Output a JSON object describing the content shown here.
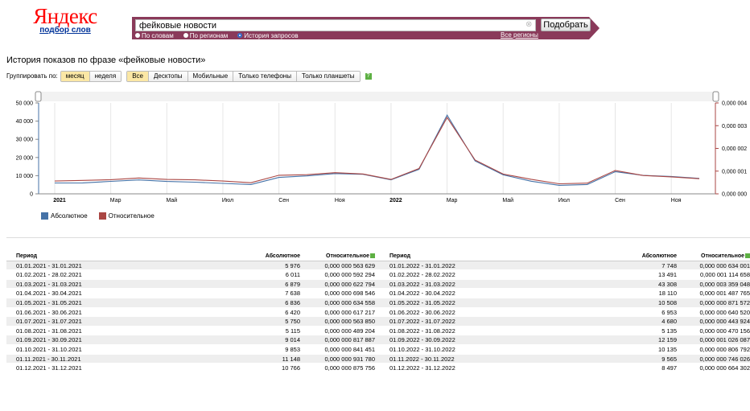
{
  "header": {
    "logo_text": "Яндекс",
    "logo_sub": "подбор слов",
    "search_value": "фейковые новости",
    "search_button": "Подобрать",
    "radios": [
      {
        "label": "По словам",
        "selected": false
      },
      {
        "label": "По регионам",
        "selected": false
      },
      {
        "label": "История запросов",
        "selected": true
      }
    ],
    "all_regions": "Все регионы",
    "panel_color": "#8a3a5a"
  },
  "page_title": "История показов по фразе «фейковые новости»",
  "group": {
    "label": "Группировать по:",
    "period_options": [
      {
        "label": "месяц",
        "active": true
      },
      {
        "label": "неделя",
        "active": false
      }
    ],
    "device_options": [
      {
        "label": "Все",
        "active": true
      },
      {
        "label": "Десктопы",
        "active": false
      },
      {
        "label": "Мобильные",
        "active": false
      },
      {
        "label": "Только телефоны",
        "active": false
      },
      {
        "label": "Только планшеты",
        "active": false
      }
    ],
    "help": "?"
  },
  "chart_data": {
    "type": "line",
    "x_labels": [
      "2021",
      "Мар",
      "Май",
      "Июл",
      "Сен",
      "Ноя",
      "2022",
      "Мар",
      "Май",
      "Июл",
      "Сен",
      "Ноя"
    ],
    "x_labels_bold": [
      "2021",
      "2022"
    ],
    "left_ticks": [
      "50 000",
      "40 000",
      "30 000",
      "20 000",
      "10 000",
      "0"
    ],
    "right_ticks": [
      "0,000 004",
      "0,000 003",
      "0,000 002",
      "0,000 001",
      "0,000 000"
    ],
    "ylim_left": [
      0,
      50000
    ],
    "ylim_right": [
      0,
      4e-06
    ],
    "series": [
      {
        "name": "Абсолютное",
        "color": "#4572a7",
        "values": [
          5976,
          6011,
          6879,
          7638,
          6836,
          6420,
          5750,
          5115,
          9014,
          9853,
          11148,
          10766,
          7748,
          13491,
          43308,
          18110,
          10508,
          6953,
          4680,
          5135,
          12159,
          10135,
          9565,
          8497
        ]
      },
      {
        "name": "Относительное",
        "color": "#aa4643",
        "values": [
          5.63629e-07,
          5.92294e-07,
          6.22794e-07,
          6.98546e-07,
          6.34558e-07,
          6.17217e-07,
          5.6385e-07,
          4.89204e-07,
          8.17887e-07,
          8.41451e-07,
          9.3178e-07,
          8.75756e-07,
          6.34001e-07,
          1.114658e-06,
          3.359048e-06,
          1.487765e-06,
          8.71572e-07,
          6.4052e-07,
          4.43924e-07,
          4.70156e-07,
          1.026087e-06,
          8.06792e-07,
          7.46026e-07,
          6.64302e-07
        ]
      }
    ]
  },
  "legend": [
    {
      "label": "Абсолютное",
      "color": "#4572a7"
    },
    {
      "label": "Относительное",
      "color": "#aa4643"
    }
  ],
  "table": {
    "headers": {
      "period": "Период",
      "abs": "Абсолютное",
      "rel": "Относительное"
    },
    "left": [
      [
        "01.01.2021 - 31.01.2021",
        "5 976",
        "0,000 000 563 629"
      ],
      [
        "01.02.2021 - 28.02.2021",
        "6 011",
        "0,000 000 592 294"
      ],
      [
        "01.03.2021 - 31.03.2021",
        "6 879",
        "0,000 000 622 794"
      ],
      [
        "01.04.2021 - 30.04.2021",
        "7 638",
        "0,000 000 698 546"
      ],
      [
        "01.05.2021 - 31.05.2021",
        "6 836",
        "0,000 000 634 558"
      ],
      [
        "01.06.2021 - 30.06.2021",
        "6 420",
        "0,000 000 617 217"
      ],
      [
        "01.07.2021 - 31.07.2021",
        "5 750",
        "0,000 000 563 850"
      ],
      [
        "01.08.2021 - 31.08.2021",
        "5 115",
        "0,000 000 489 204"
      ],
      [
        "01.09.2021 - 30.09.2021",
        "9 014",
        "0,000 000 817 887"
      ],
      [
        "01.10.2021 - 31.10.2021",
        "9 853",
        "0,000 000 841 451"
      ],
      [
        "01.11.2021 - 30.11.2021",
        "11 148",
        "0,000 000 931 780"
      ],
      [
        "01.12.2021 - 31.12.2021",
        "10 766",
        "0,000 000 875 756"
      ]
    ],
    "right": [
      [
        "01.01.2022 - 31.01.2022",
        "7 748",
        "0,000 000 634 001"
      ],
      [
        "01.02.2022 - 28.02.2022",
        "13 491",
        "0,000 001 114 658"
      ],
      [
        "01.03.2022 - 31.03.2022",
        "43 308",
        "0,000 003 359 048"
      ],
      [
        "01.04.2022 - 30.04.2022",
        "18 110",
        "0,000 001 487 765"
      ],
      [
        "01.05.2022 - 31.05.2022",
        "10 508",
        "0,000 000 871 572"
      ],
      [
        "01.06.2022 - 30.06.2022",
        "6 953",
        "0,000 000 640 520"
      ],
      [
        "01.07.2022 - 31.07.2022",
        "4 680",
        "0,000 000 443 924"
      ],
      [
        "01.08.2022 - 31.08.2022",
        "5 135",
        "0,000 000 470 156"
      ],
      [
        "01.09.2022 - 30.09.2022",
        "12 159",
        "0,000 001 026 087"
      ],
      [
        "01.10.2022 - 31.10.2022",
        "10 135",
        "0,000 000 806 792"
      ],
      [
        "01.11.2022 - 30.11.2022",
        "9 565",
        "0,000 000 746 026"
      ],
      [
        "01.12.2022 - 31.12.2022",
        "8 497",
        "0,000 000 664 302"
      ]
    ]
  }
}
